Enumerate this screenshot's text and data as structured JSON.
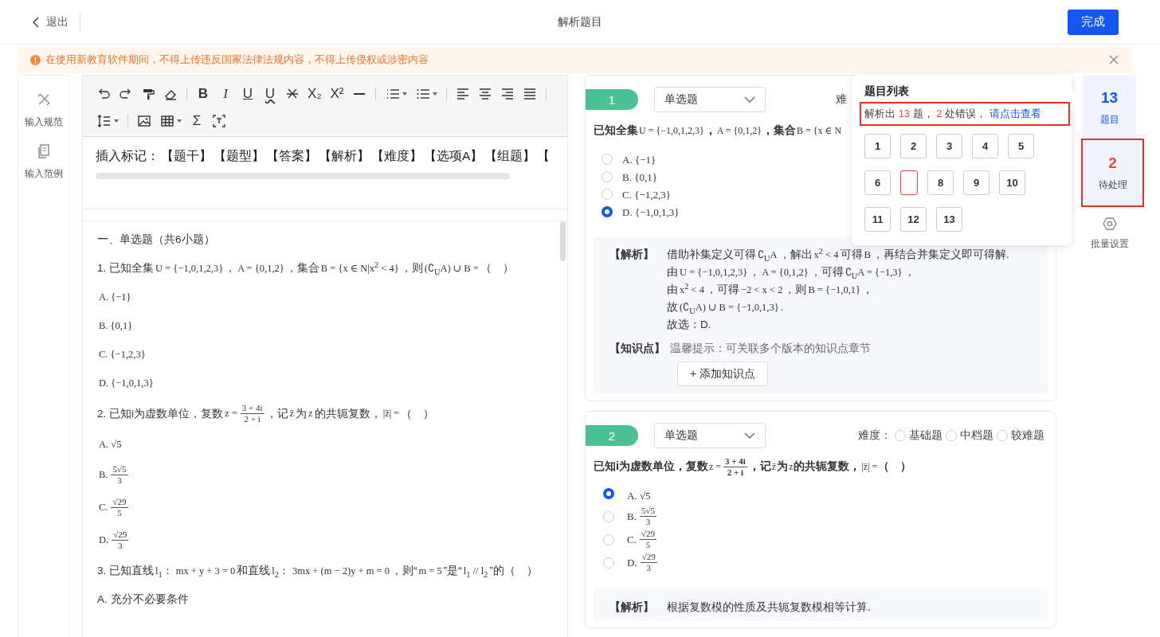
{
  "header": {
    "back_label": "退出",
    "title": "解析题目",
    "done_button": "完成"
  },
  "notice": {
    "text": "在使用新教育软件期间，不得上传违反国家法律法规内容，不得上传侵权或涉密内容"
  },
  "left_nav": [
    {
      "kind": "rules",
      "label": "输入规范"
    },
    {
      "kind": "example",
      "label": "输入范例"
    }
  ],
  "editor": {
    "toolbar": [
      {
        "kind": "undo"
      },
      {
        "kind": "redo"
      },
      {
        "kind": "painter"
      },
      {
        "kind": "eraser"
      },
      {
        "kind": "sep"
      },
      {
        "kind": "bold",
        "label": "B"
      },
      {
        "kind": "italic",
        "label": "I"
      },
      {
        "kind": "underline",
        "label": "U"
      },
      {
        "kind": "wavy",
        "label": "U"
      },
      {
        "kind": "strike"
      },
      {
        "kind": "subscript",
        "label": "X₂"
      },
      {
        "kind": "superscript",
        "label": "X²"
      },
      {
        "kind": "hr"
      },
      {
        "kind": "sep"
      },
      {
        "kind": "ol"
      },
      {
        "kind": "ul"
      },
      {
        "kind": "sep"
      },
      {
        "kind": "align-left"
      },
      {
        "kind": "align-center"
      },
      {
        "kind": "align-right"
      },
      {
        "kind": "align-justify"
      },
      {
        "kind": "sep"
      },
      {
        "kind": "break"
      },
      {
        "kind": "line-height"
      },
      {
        "kind": "sep"
      },
      {
        "kind": "image"
      },
      {
        "kind": "table"
      },
      {
        "kind": "formula",
        "label": "Σ"
      },
      {
        "kind": "textbox"
      }
    ],
    "insert_label": "插入标记：",
    "insert_marks": [
      "【题干】",
      "【题型】",
      "【答案】",
      "【解析】",
      "【难度】",
      "【选项A】",
      "【组题】",
      "【"
    ],
    "lines": [
      [
        {
          "text": "一、单选题（共6小题）"
        }
      ],
      [
        {
          "text": "1. 已知全集"
        },
        {
          "math": "U = {−1,0,1,2,3}"
        },
        {
          "text": "，"
        },
        {
          "math": "A = {0,1,2}"
        },
        {
          "text": "，集合"
        },
        {
          "math": "B = {x ∈ N|x$^{2}$ < 4}"
        },
        {
          "text": "，则"
        },
        {
          "math": "(∁$_{U}$A) ∪ B ="
        },
        {
          "text": "（　）"
        }
      ],
      [
        {
          "math": "A. {−1}"
        }
      ],
      [
        {
          "math": "B. {0,1}"
        }
      ],
      [
        {
          "math": "C. {−1,2,3}"
        }
      ],
      [
        {
          "math": "D. {−1,0,1,3}"
        }
      ],
      [
        {
          "text": "2. 已知i为虚数单位，复数"
        },
        {
          "math": "z ="
        },
        {
          "num": "3 + 4i",
          "den": "2 + i"
        },
        {
          "text": "，记"
        },
        {
          "math": "z̄"
        },
        {
          "text": "为"
        },
        {
          "math": "z"
        },
        {
          "text": "的共轭复数，"
        },
        {
          "math": "|z̄| ="
        },
        {
          "text": "（　）"
        }
      ],
      [
        {
          "math": "A. √5"
        }
      ],
      [
        {
          "math": "B."
        },
        {
          "num": "5√5",
          "den": "3"
        }
      ],
      [
        {
          "math": "C."
        },
        {
          "num": "√29",
          "den": "5"
        }
      ],
      [
        {
          "math": "D."
        },
        {
          "num": "√29",
          "den": "3"
        }
      ],
      [
        {
          "text": "3. 已知直线"
        },
        {
          "math": "l$_{1}$："
        },
        {
          "math": "mx + y + 3 = 0"
        },
        {
          "text": "和直线"
        },
        {
          "math": "l$_{2}$："
        },
        {
          "math": "3mx + (m − 2)y + m = 0"
        },
        {
          "text": "，则“"
        },
        {
          "math": "m = 5"
        },
        {
          "text": "”是“"
        },
        {
          "math": "l$_{1}$ // l$_{2}$"
        },
        {
          "text": "”的（　）"
        }
      ],
      [
        {
          "text": "A. 充分不必要条件"
        }
      ]
    ]
  },
  "questions": [
    {
      "number": "1",
      "type": "单选题",
      "difficulty_label": "难",
      "stem": [
        {
          "text": "已知全集"
        },
        {
          "math": "U = {−1,0,1,2,3}"
        },
        {
          "text": "，"
        },
        {
          "math": "A = {0,1,2}"
        },
        {
          "text": "，集合"
        },
        {
          "math": "B = {x ∈ N"
        }
      ],
      "options": [
        {
          "selected": false,
          "parts": [
            {
              "math": "A. {−1}"
            }
          ]
        },
        {
          "selected": false,
          "parts": [
            {
              "math": "B. {0,1}"
            }
          ]
        },
        {
          "selected": false,
          "parts": [
            {
              "math": "C. {−1,2,3}"
            }
          ]
        },
        {
          "selected": true,
          "parts": [
            {
              "math": "D. {−1,0,1,3}"
            }
          ]
        }
      ],
      "analysis_label": "【解析】",
      "analysis": [
        [
          {
            "text": "借助补集定义可得"
          },
          {
            "math": "∁$_{U}$A"
          },
          {
            "text": "，解出"
          },
          {
            "math": "x$^{2}$ < 4"
          },
          {
            "text": "可得"
          },
          {
            "math": "B"
          },
          {
            "text": "，再结合并集定义即可得解."
          }
        ],
        [
          {
            "text": "由"
          },
          {
            "math": "U = {−1,0,1,2,3}"
          },
          {
            "text": "，"
          },
          {
            "math": "A = {0,1,2}"
          },
          {
            "text": "，可得"
          },
          {
            "math": "∁$_{U}$A = {−1,3}"
          },
          {
            "text": "，"
          }
        ],
        [
          {
            "text": "由"
          },
          {
            "math": "x$^{2}$ < 4"
          },
          {
            "text": "，可得"
          },
          {
            "math": "−2 < x < 2"
          },
          {
            "text": "，则"
          },
          {
            "math": "B = {−1,0,1}"
          },
          {
            "text": "，"
          }
        ],
        [
          {
            "text": "故"
          },
          {
            "math": "(∁$_{U}$A) ∪ B = {−1,0,1,3}"
          },
          {
            "text": "."
          }
        ],
        [
          {
            "text": "故选：D."
          }
        ]
      ],
      "knowledge_label": "【知识点】",
      "knowledge_hint": "温馨提示：可关联多个版本的知识点章节",
      "add_button": "+ 添加知识点"
    },
    {
      "number": "2",
      "type": "单选题",
      "difficulty_label": "难度：",
      "difficulty_options": [
        {
          "label": "基础题",
          "selected": false
        },
        {
          "label": "中档题",
          "selected": false
        },
        {
          "label": "较难题",
          "selected": false
        }
      ],
      "stem": [
        {
          "text": "已知i为虚数单位，复数"
        },
        {
          "math": "z ="
        },
        {
          "num": "3 + 4i",
          "den": "2 + i"
        },
        {
          "text": "，记"
        },
        {
          "math": "z̄"
        },
        {
          "text": "为"
        },
        {
          "math": "z"
        },
        {
          "text": "的共轭复数，"
        },
        {
          "math": "|z̄| ="
        },
        {
          "text": "（　）"
        }
      ],
      "options": [
        {
          "selected": true,
          "parts": [
            {
              "math": "A. √5"
            }
          ]
        },
        {
          "selected": false,
          "parts": [
            {
              "math": "B."
            },
            {
              "num": "5√5",
              "den": "3"
            }
          ]
        },
        {
          "selected": false,
          "parts": [
            {
              "math": "C."
            },
            {
              "num": "√29",
              "den": "5"
            }
          ]
        },
        {
          "selected": false,
          "parts": [
            {
              "math": "D."
            },
            {
              "num": "√29",
              "den": "3"
            }
          ]
        }
      ],
      "analysis_label": "【解析】",
      "analysis": [
        [
          {
            "text": "根据复数模的性质及共轭复数模相等计算."
          }
        ]
      ]
    }
  ],
  "popup": {
    "title": "题目列表",
    "highlighted": true,
    "summary": {
      "prefix": "解析出",
      "count": "13",
      "mid": "题，",
      "errors": "2",
      "suffix": "处错误，",
      "link": "请点击查看"
    },
    "items": [
      {
        "label": "1",
        "error": false
      },
      {
        "label": "2",
        "error": false
      },
      {
        "label": "3",
        "error": false
      },
      {
        "label": "4",
        "error": false
      },
      {
        "label": "5",
        "error": false
      },
      {
        "label": "6",
        "error": false
      },
      {
        "error": true
      },
      {
        "label": "8",
        "error": false
      },
      {
        "label": "9",
        "error": false
      },
      {
        "label": "10",
        "error": false
      },
      {
        "label": "11",
        "error": false
      },
      {
        "label": "12",
        "error": false
      },
      {
        "label": "13",
        "error": false
      }
    ]
  },
  "rail": [
    {
      "kind": "tab",
      "count": "13",
      "label": "题目",
      "selected": true,
      "highlighted": false
    },
    {
      "kind": "tab",
      "count": "2",
      "label": "待处理",
      "selected": false,
      "highlighted": true
    },
    {
      "kind": "settings",
      "label": "批量设置"
    }
  ]
}
